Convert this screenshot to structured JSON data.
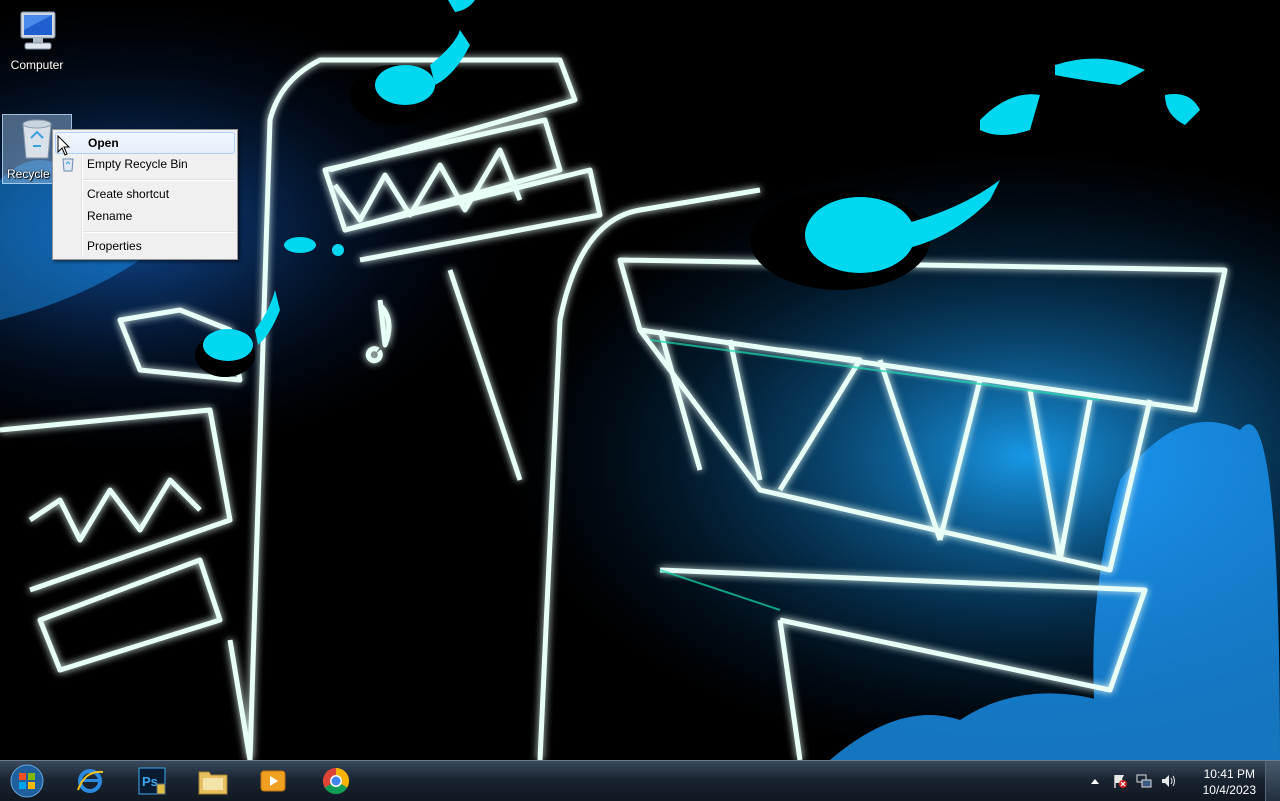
{
  "desktop": {
    "icons": [
      {
        "label": "Computer"
      },
      {
        "label": "Recycle Bin"
      }
    ]
  },
  "context_menu": {
    "items": [
      {
        "label": "Open"
      },
      {
        "label": "Empty Recycle Bin"
      },
      {
        "label": "Create shortcut"
      },
      {
        "label": "Rename"
      },
      {
        "label": "Properties"
      }
    ]
  },
  "taskbar": {
    "pinned": [
      "start-orb-icon",
      "internet-explorer-icon",
      "photoshop-icon",
      "file-explorer-icon",
      "media-player-icon",
      "chrome-icon"
    ],
    "clock": {
      "time": "10:41 PM",
      "date": "10/4/2023"
    }
  },
  "colors": {
    "accent": "#00d8f0",
    "neon_outline": "#e8fff8",
    "glow": "#1ad8b0",
    "taskbar": "#1a2533"
  }
}
